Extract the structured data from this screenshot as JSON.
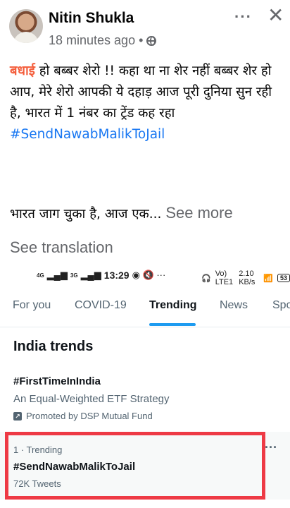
{
  "post": {
    "author": "Nitin Shukla",
    "time": "18 minutes ago",
    "separator": "•",
    "more_icon": "more-dots-icon",
    "close_icon": "close-icon",
    "privacy_icon": "globe-icon",
    "text_keyword": "बधाई",
    "text_body": " हो बब्बर शेरो !! कहा था ना शेर नहीं बब्बर शेर हो आप, मेरे शेरो आपकी ये दहाड़ आज पूरी दुनिया सुन रही है, भारत में 1 नंबर का ट्रेंड कह रहा",
    "hashtag": "#SendNawabMalikToJail",
    "text_line2": "भारत जाग चुका है, आज एक...",
    "see_more": "See more",
    "see_translation": "See translation"
  },
  "status_bar": {
    "net1": "4G",
    "net2": "3G",
    "time": "13:29",
    "icons_left": "◉ 🔇 ···",
    "volte": "Vo) LTE1",
    "speed": "2.10 KB/s",
    "battery": "53"
  },
  "twitter": {
    "tabs": [
      "For you",
      "COVID-19",
      "Trending",
      "News",
      "Spo"
    ],
    "section_title": "India trends",
    "promo": {
      "tag": "#FirstTimeInIndia",
      "desc": "An Equal-Weighted ETF Strategy",
      "by": "Promoted by DSP Mutual Fund"
    },
    "trend": {
      "meta": "1 · Trending",
      "tag": "#SendNawabMalikToJail",
      "count": "72K Tweets"
    }
  },
  "colors": {
    "highlight": "#ee3a45",
    "accent": "#1d9bf0",
    "keyword": "#f45e3c",
    "link": "#1877f2"
  }
}
